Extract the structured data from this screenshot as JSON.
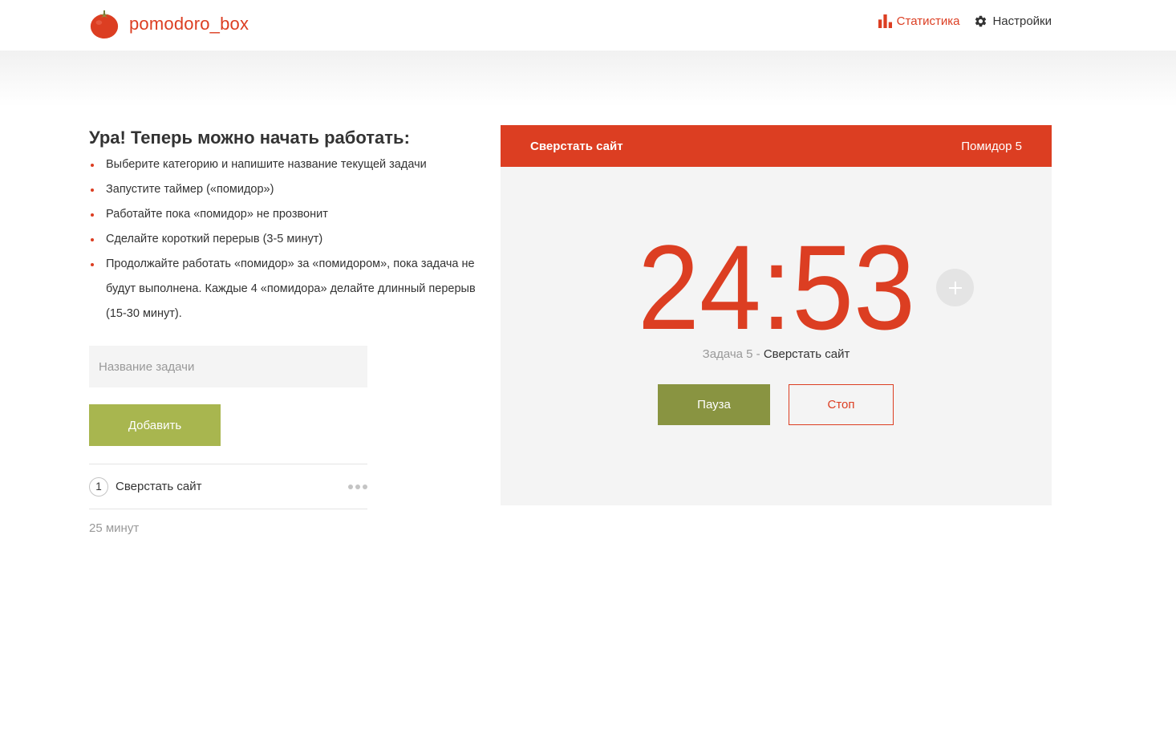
{
  "header": {
    "logo_text": "pomodoro_box",
    "logo_icon": "tomato-icon",
    "nav": {
      "stats_label": "Статистика",
      "stats_icon": "bar-chart-icon",
      "settings_label": "Настройки",
      "settings_icon": "gear-icon"
    }
  },
  "intro": {
    "title": "Ура! Теперь можно начать работать:",
    "steps": [
      "Выберите категорию и напишите название текущей задачи",
      "Запустите таймер («помидор»)",
      "Работайте пока «помидор» не прозвонит",
      "Сделайте короткий перерыв (3-5 минут)",
      "Продолжайте работать «помидор» за «помидором», пока задача не будут выполнена. Каждые 4 «помидора» делайте длинный перерыв (15-30 минут)."
    ]
  },
  "form": {
    "task_placeholder": "Название задачи",
    "task_value": "",
    "add_label": "Добавить"
  },
  "tasks": [
    {
      "count": "1",
      "name": "Сверстать сайт"
    }
  ],
  "total_time": "25 минут",
  "timer": {
    "task_title": "Сверстать сайт",
    "pomodoro_label": "Помидор 5",
    "time": "24:53",
    "caption_label": "Задача 5 - ",
    "caption_task": "Сверстать сайт",
    "pause_label": "Пауза",
    "stop_label": "Стоп",
    "plus_icon": "plus-icon"
  },
  "colors": {
    "accent": "#dc3e22",
    "green": "#a8b64f",
    "dark_green": "#899441",
    "card_bg": "#f4f4f4",
    "muted": "#999999"
  }
}
